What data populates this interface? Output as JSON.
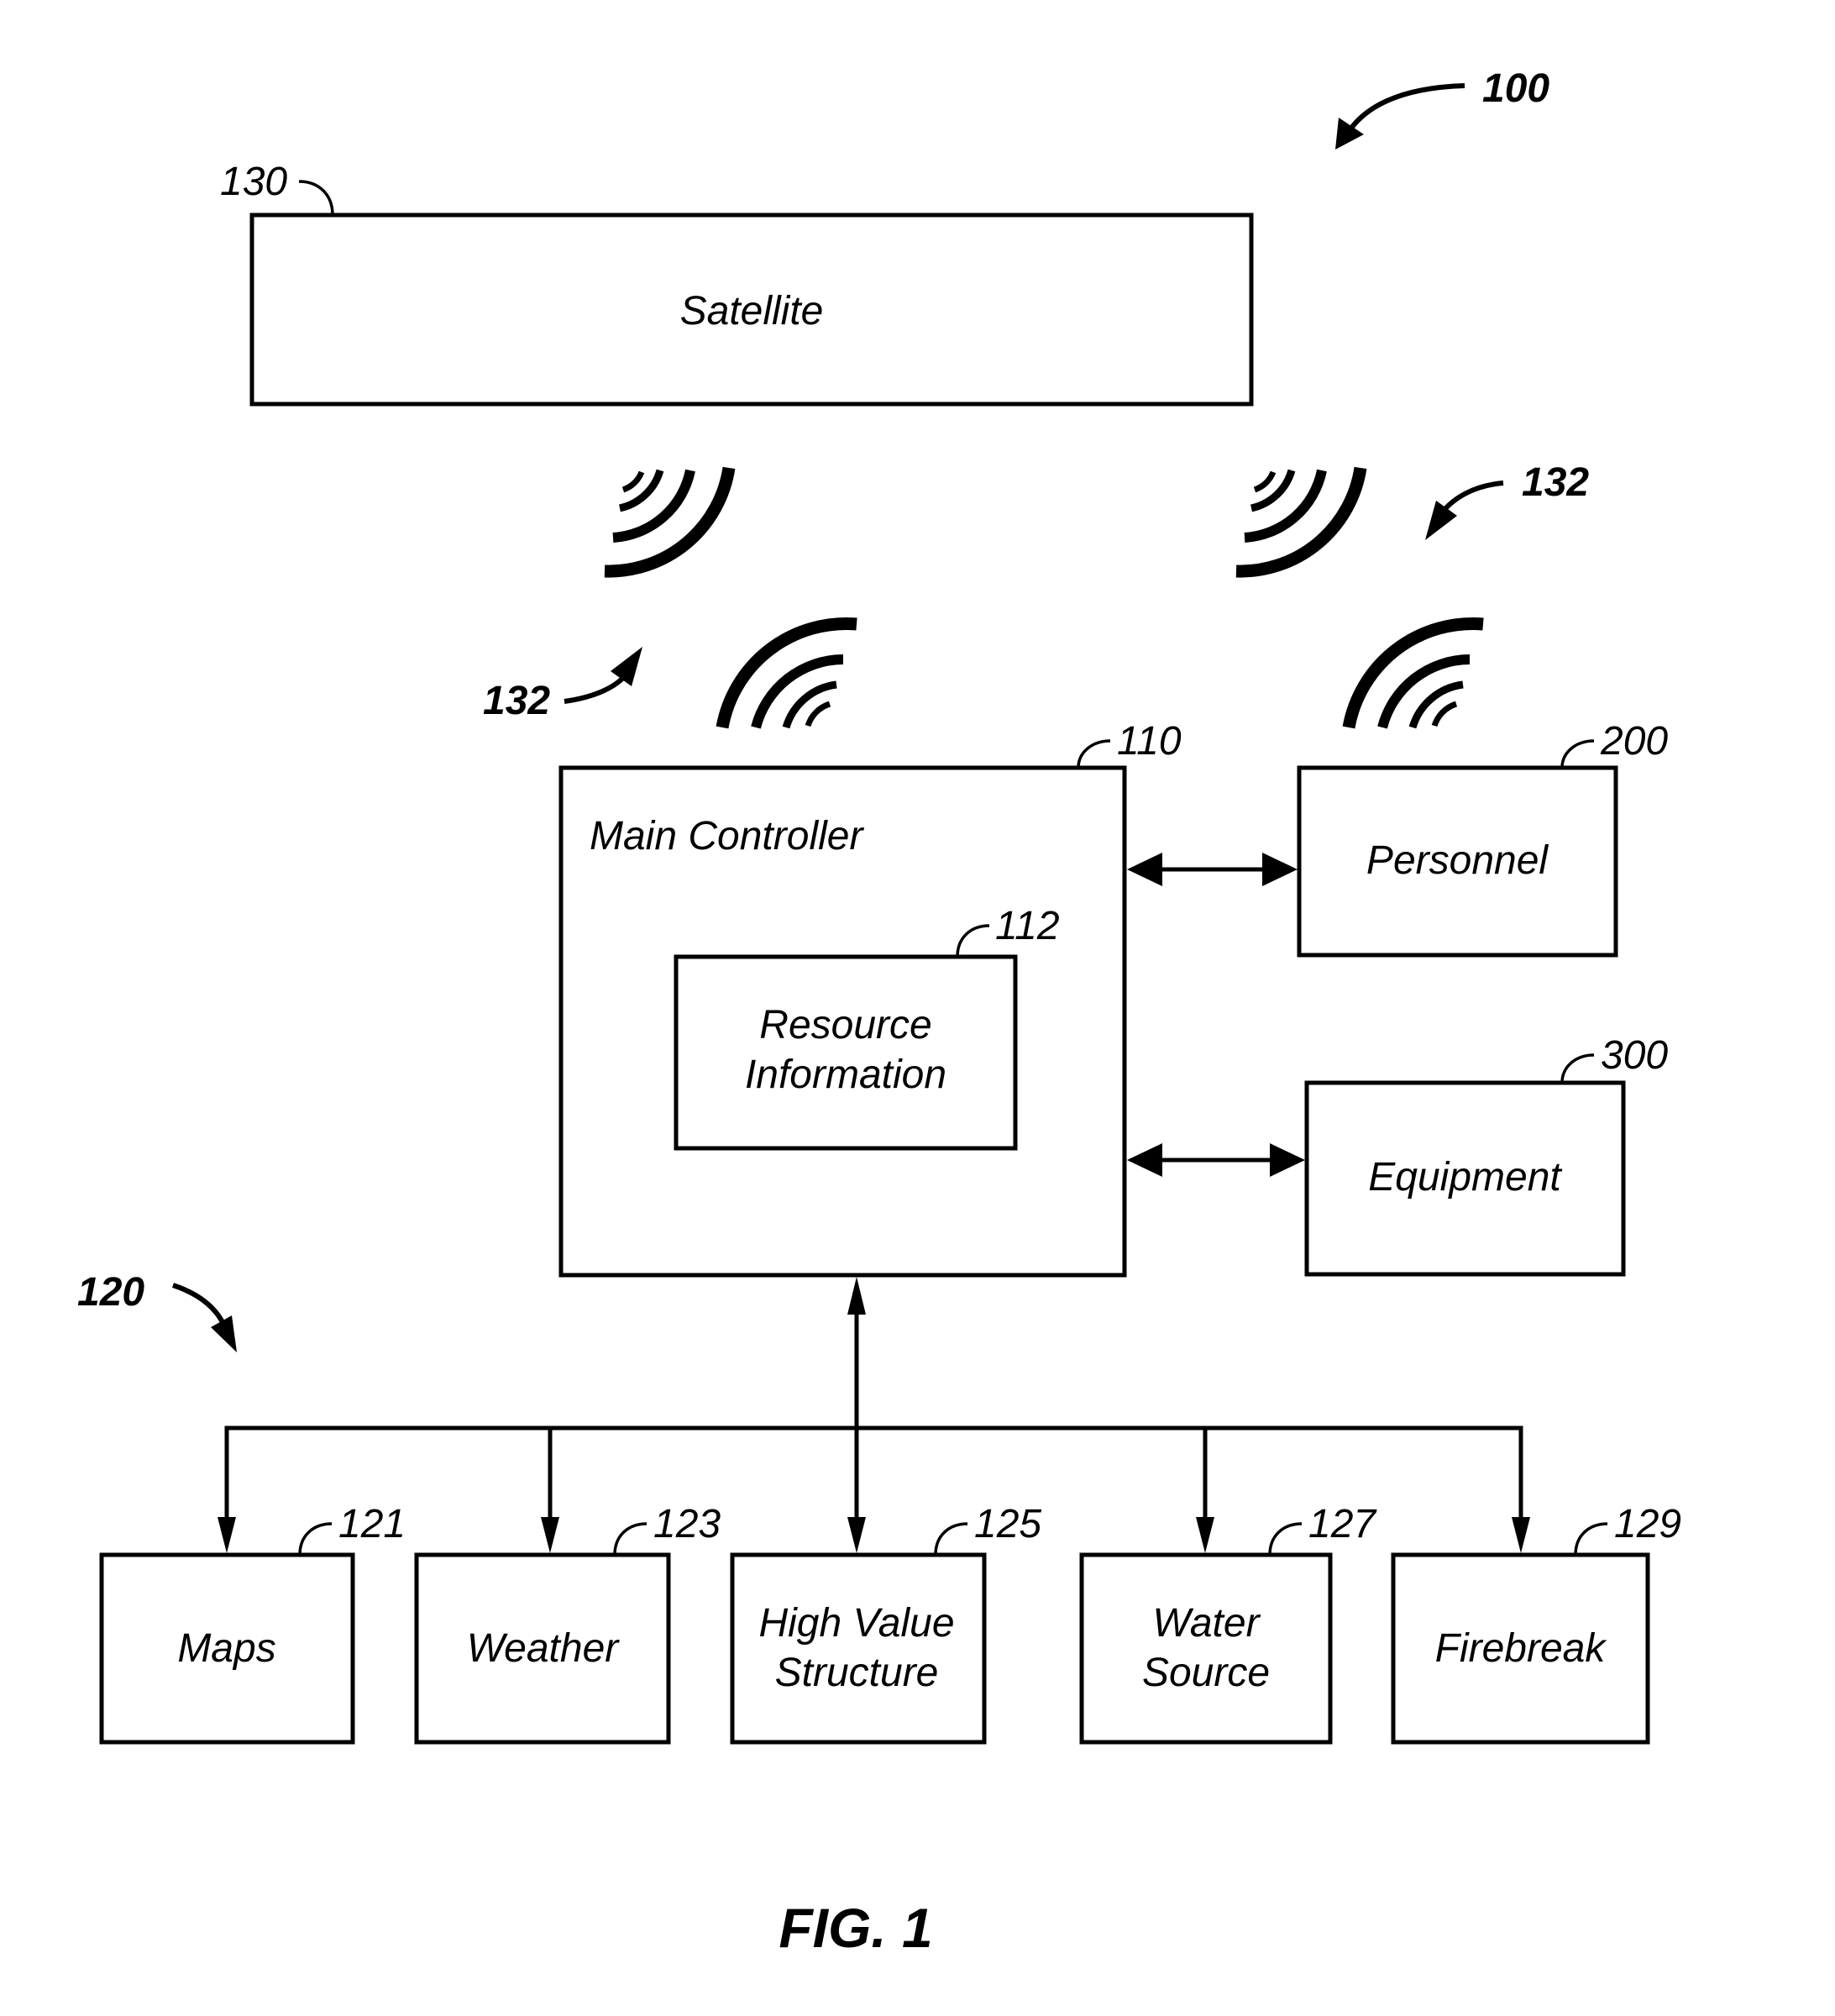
{
  "figure": {
    "caption": "FIG. 1",
    "system_ref": "100"
  },
  "satellite": {
    "label": "Satellite",
    "ref": "130"
  },
  "wireless_links": {
    "ref": "132"
  },
  "main_controller": {
    "label": "Main Controller",
    "ref": "110",
    "resource_information": {
      "label_lines": [
        "Resource",
        "Information"
      ],
      "ref": "112"
    }
  },
  "personnel": {
    "label": "Personnel",
    "ref": "200"
  },
  "equipment": {
    "label": "Equipment",
    "ref": "300"
  },
  "data_sources": {
    "ref": "120",
    "items": [
      {
        "label_lines": [
          "Maps"
        ],
        "ref": "121"
      },
      {
        "label_lines": [
          "Weather"
        ],
        "ref": "123"
      },
      {
        "label_lines": [
          "High Value",
          "Structure"
        ],
        "ref": "125"
      },
      {
        "label_lines": [
          "Water",
          "Source"
        ],
        "ref": "127"
      },
      {
        "label_lines": [
          "Firebreak"
        ],
        "ref": "129"
      }
    ]
  }
}
